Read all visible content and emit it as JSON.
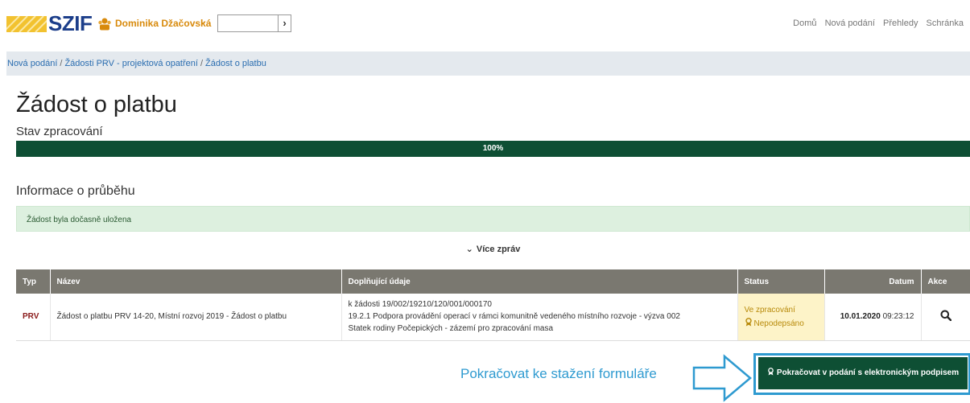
{
  "header": {
    "logo_text": "SZIF",
    "user_name": "Dominika Džačovská",
    "search_value": "",
    "search_button": "›",
    "nav": [
      "Domů",
      "Nová podání",
      "Přehledy",
      "Schránka"
    ]
  },
  "breadcrumb": [
    "Nová podání",
    "Žádosti PRV - projektová opatření",
    "Žádost o platbu"
  ],
  "page_title": "Žádost o platbu",
  "progress": {
    "label": "Stav zpracování",
    "value_percent": 100,
    "text": "100%"
  },
  "section_title": "Informace o průběhu",
  "alert_text": "Žádost byla dočasně uložena",
  "more_messages": "Více zpráv",
  "table": {
    "headers": [
      "Typ",
      "Název",
      "Doplňující údaje",
      "Status",
      "Datum",
      "Akce"
    ],
    "rows": [
      {
        "typ": "PRV",
        "nazev": "Žádost o platbu PRV 14-20, Místní rozvoj 2019 - Žádost o platbu",
        "detail_1": "k žádosti 19/002/19210/120/001/000170",
        "detail_2": "19.2.1 Podpora provádění operací v rámci komunitně vedeného místního rozvoje - výzva 002",
        "detail_3": "Statek rodiny Počepických - zázemí pro zpracování masa",
        "status_1": "Ve zpracování",
        "status_2": "Nepodepsáno",
        "date": "10.01.2020",
        "time": "09:23:12"
      }
    ]
  },
  "hint_text": "Pokračovat ke stažení formuláře",
  "cta_label": "Pokračovat v podání s elektronickým podpisem",
  "colors": {
    "brand_blue": "#1c3e8a",
    "accent_orange": "#d88a0c",
    "dark_green": "#0e4f34",
    "highlight_blue": "#2e9ad0"
  }
}
